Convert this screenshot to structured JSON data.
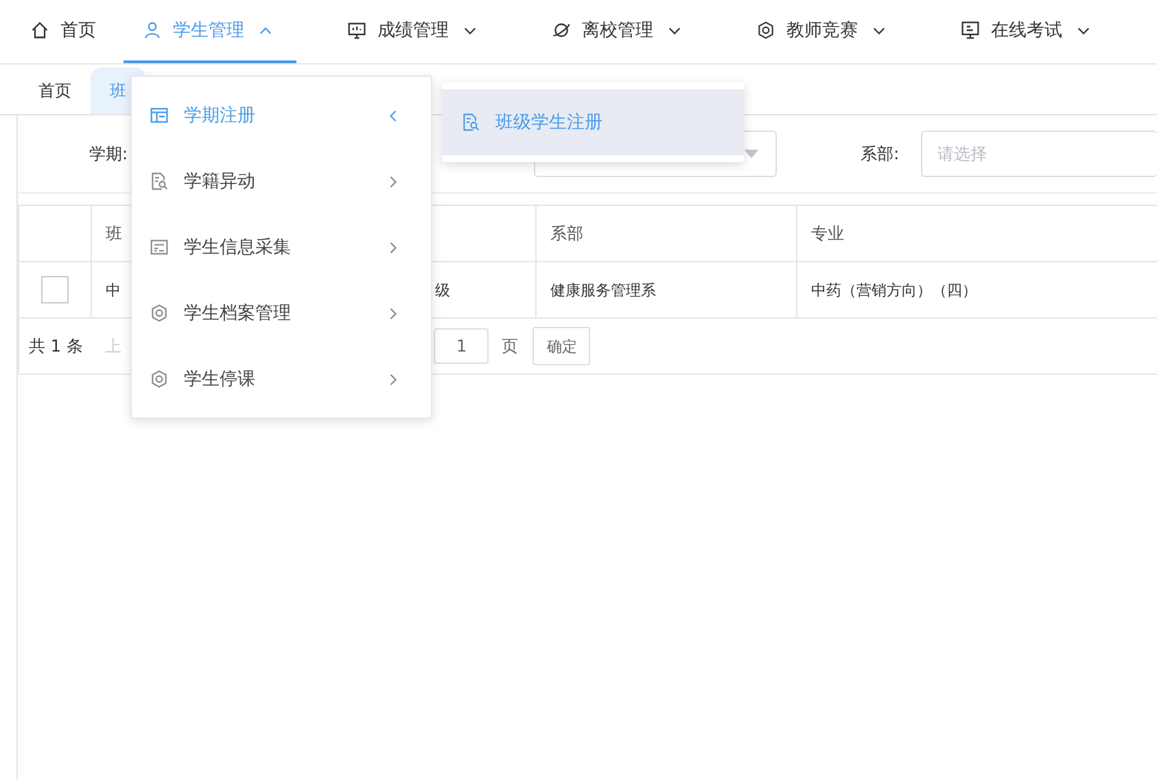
{
  "nav": [
    {
      "label": "首页",
      "kind": "link",
      "selected": false
    },
    {
      "label": "学生管理",
      "kind": "dropdown",
      "selected": true,
      "expanded": true
    },
    {
      "label": "成绩管理",
      "kind": "dropdown",
      "selected": false,
      "expanded": false
    },
    {
      "label": "离校管理",
      "kind": "dropdown",
      "selected": false,
      "expanded": false
    },
    {
      "label": "教师竞赛",
      "kind": "dropdown",
      "selected": false,
      "expanded": false
    },
    {
      "label": "在线考试",
      "kind": "dropdown",
      "selected": false,
      "expanded": false
    }
  ],
  "tabs": [
    {
      "label": "首页",
      "selected": false
    },
    {
      "label": "班",
      "selected": true
    }
  ],
  "filters": {
    "term_label": "学期:",
    "dept_label": "系部:",
    "dept_placeholder": "请选择"
  },
  "table": {
    "columns": [
      "班",
      "",
      "系部",
      "专业"
    ],
    "rows": [
      {
        "checked": false,
        "cells": [
          "中",
          "级",
          "健康服务管理系",
          "中药（营销方向）（四）"
        ]
      }
    ]
  },
  "pagination": {
    "total": "共 1 条",
    "prev": "上",
    "page": "1",
    "page_unit": "页",
    "confirm": "确定"
  },
  "menu": {
    "items": [
      {
        "label": "学期注册",
        "selected": true,
        "expanded": true
      },
      {
        "label": "学籍异动",
        "selected": false,
        "expanded": false
      },
      {
        "label": "学生信息采集",
        "selected": false,
        "expanded": false
      },
      {
        "label": "学生档案管理",
        "selected": false,
        "expanded": false
      },
      {
        "label": "学生停课",
        "selected": false,
        "expanded": false
      }
    ],
    "submenu": [
      {
        "label": "班级学生注册",
        "selected": true
      }
    ]
  }
}
